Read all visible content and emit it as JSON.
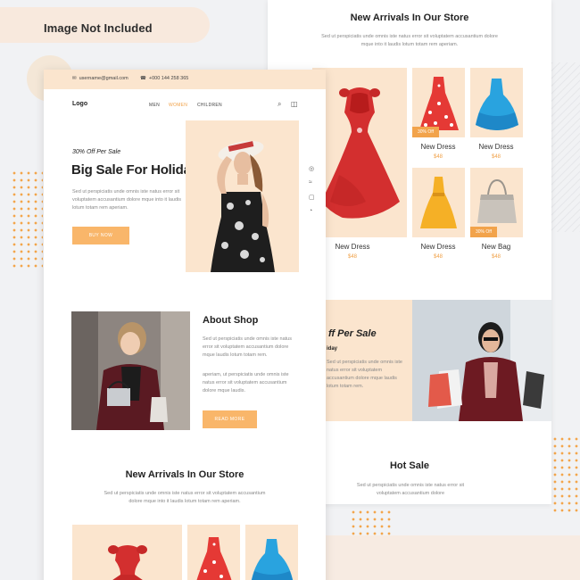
{
  "ribbon": {
    "label": "Image Not Included"
  },
  "colors": {
    "accent": "#f2a34b",
    "peach": "#fbe5ce"
  },
  "topbar": {
    "email": "username@gmail.com",
    "phone": "+000 144 258 365",
    "email_icon": "mail-icon",
    "phone_icon": "phone-icon"
  },
  "nav": {
    "logo": "Logo",
    "links": [
      "MEN",
      "WOMEN",
      "CHILDREN"
    ],
    "active": "WOMEN",
    "icons": [
      "search-icon",
      "bag-icon"
    ]
  },
  "hero": {
    "small": "30% Off Per Sale",
    "title": "Big Sale For Holiday",
    "text": "Sed ut perspiciatis unde omnis iste natus error sit voluptatem accusantium dolore mque into it laudis lotum totam rem aperiam.",
    "button": "BUY NOW"
  },
  "social": [
    "instagram-icon",
    "twitter-icon",
    "facebook-icon",
    "rss-icon"
  ],
  "about": {
    "title": "About Shop",
    "text1": "Sed ut perspiciatis unde omnis iste natus error sit voluptatem accusantium dolore mque laudis lotum totam rem.",
    "text2": "aperiam, ut perspiciatis unde omnis iste natus error sit voluptatem accusantium dolore mque laudis.",
    "button": "READ MORE"
  },
  "new_arrivals": {
    "title": "New Arrivals In Our Store",
    "sub": "Sed ut perspiciatis unde omnis iste natus error sit voluptatem accusantium dolore mque into it laudis lotum totam rem aperiam.",
    "products": [
      {
        "name": "New Dress",
        "price": "$48",
        "badge": ""
      },
      {
        "name": "New Dress",
        "price": "$48",
        "badge": "30% Off"
      },
      {
        "name": "New Dress",
        "price": "$48",
        "badge": ""
      },
      {
        "name": "New Dress",
        "price": "$48",
        "badge": ""
      },
      {
        "name": "New Bag",
        "price": "$48",
        "badge": "30% Off"
      }
    ]
  },
  "right_banner": {
    "title": "ff Per Sale",
    "sub": "iday",
    "text": "Sed ut perspiciatis unde omnis iste natus error sit voluptatem accusantium dolore mque laudis lotum totam rem."
  },
  "hot_sale": {
    "title": "Hot Sale",
    "sub": "Sed ut perspiciatis unde omnis iste natus error sit voluptatem accusantium dolore"
  }
}
